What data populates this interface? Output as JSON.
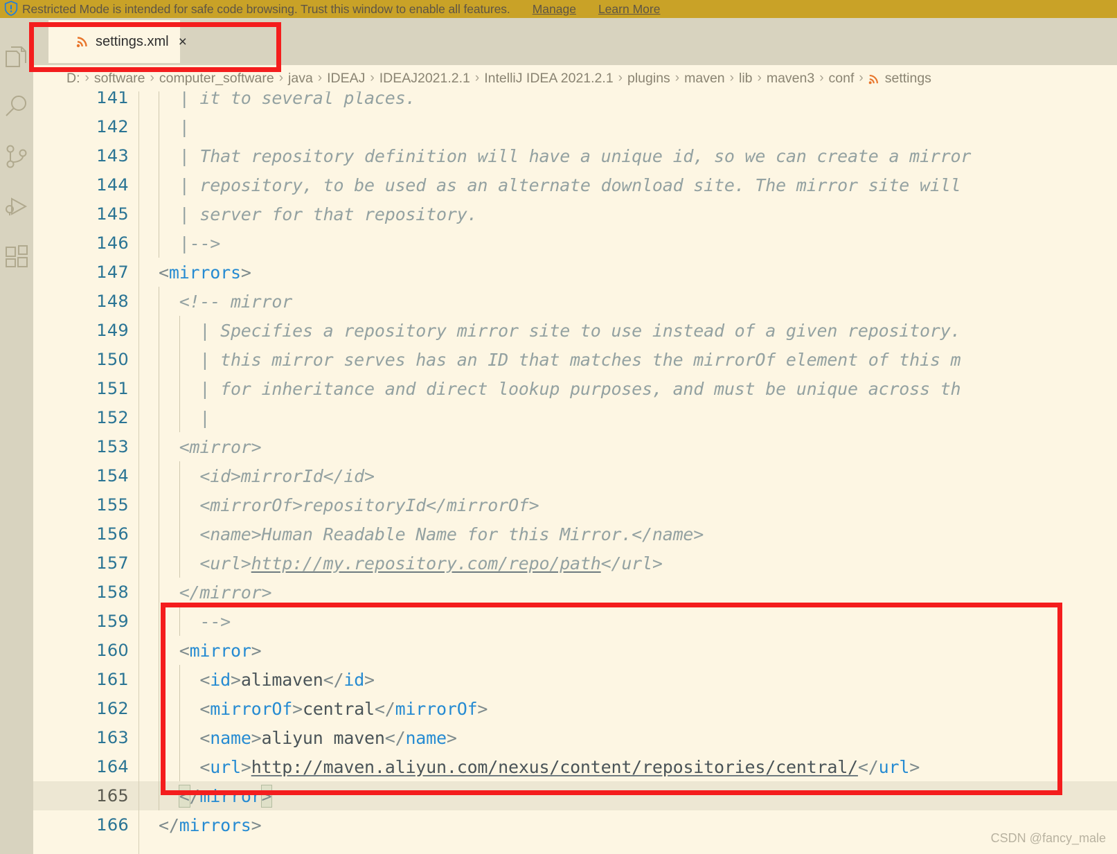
{
  "banner": {
    "icon": "shield-warning-icon",
    "message": "Restricted Mode is intended for safe code browsing. Trust this window to enable all features.",
    "manage_label": "Manage",
    "learn_more_label": "Learn More",
    "background_color": "#C9A227",
    "text_color": "#5E5545"
  },
  "activitybar": {
    "items": [
      {
        "icon": "explorer-files-icon",
        "label": "Explorer"
      },
      {
        "icon": "search-magnifier-icon",
        "label": "Search"
      },
      {
        "icon": "source-control-branch-icon",
        "label": "Source Control"
      },
      {
        "icon": "run-debug-play-icon",
        "label": "Run and Debug"
      },
      {
        "icon": "extensions-blocks-icon",
        "label": "Extensions"
      }
    ],
    "background_color": "#D8D3BF"
  },
  "tabs": [
    {
      "icon": "xml-file-icon",
      "label": "settings.xml",
      "close_label": "×",
      "active": true
    }
  ],
  "breadcrumb": {
    "icon": "xml-file-icon",
    "separator": "›",
    "items": [
      "D:",
      "software",
      "computer_software",
      "java",
      "IDEAJ",
      "IDEAJ2021.2.1",
      "IntelliJ IDEA 2021.2.1",
      "plugins",
      "maven",
      "lib",
      "maven3",
      "conf"
    ],
    "file": "settings"
  },
  "editor": {
    "background_color": "#FDF6E3",
    "line_number_color": "#2A7494",
    "active_line_color": "#EDE7D3",
    "comment_color": "#93A1A1",
    "tag_color": "#268BD2",
    "active_line": 165,
    "lines": [
      {
        "n": 141,
        "indent": 1,
        "guides": [
          1
        ],
        "parts": [
          {
            "t": "cmt",
            "s": "| it to several places."
          }
        ]
      },
      {
        "n": 142,
        "indent": 1,
        "guides": [
          1
        ],
        "parts": [
          {
            "t": "cmt",
            "s": "|"
          }
        ]
      },
      {
        "n": 143,
        "indent": 1,
        "guides": [
          1
        ],
        "parts": [
          {
            "t": "cmt",
            "s": "| That repository definition will have a unique id, so we can create a mirror"
          }
        ]
      },
      {
        "n": 144,
        "indent": 1,
        "guides": [
          1
        ],
        "parts": [
          {
            "t": "cmt",
            "s": "| repository, to be used as an alternate download site. The mirror site will"
          }
        ]
      },
      {
        "n": 145,
        "indent": 1,
        "guides": [
          1
        ],
        "parts": [
          {
            "t": "cmt",
            "s": "| server for that repository."
          }
        ]
      },
      {
        "n": 146,
        "indent": 1,
        "guides": [
          1
        ],
        "parts": [
          {
            "t": "cmt-plain",
            "s": "|-->"
          }
        ]
      },
      {
        "n": 147,
        "indent": 0,
        "guides": [],
        "parts": [
          {
            "t": "brk",
            "s": "<"
          },
          {
            "t": "tagname",
            "s": "mirrors"
          },
          {
            "t": "brk",
            "s": ">"
          }
        ]
      },
      {
        "n": 148,
        "indent": 1,
        "guides": [
          1
        ],
        "parts": [
          {
            "t": "cmt",
            "s": "<!-- mirror"
          }
        ]
      },
      {
        "n": 149,
        "indent": 2,
        "guides": [
          1,
          2
        ],
        "parts": [
          {
            "t": "cmt",
            "s": "| Specifies a repository mirror site to use instead of a given repository."
          }
        ]
      },
      {
        "n": 150,
        "indent": 2,
        "guides": [
          1,
          2
        ],
        "parts": [
          {
            "t": "cmt",
            "s": "| this mirror serves has an ID that matches the mirrorOf element of this m"
          }
        ]
      },
      {
        "n": 151,
        "indent": 2,
        "guides": [
          1,
          2
        ],
        "parts": [
          {
            "t": "cmt",
            "s": "| for inheritance and direct lookup purposes, and must be unique across th"
          }
        ]
      },
      {
        "n": 152,
        "indent": 2,
        "guides": [
          1,
          2
        ],
        "parts": [
          {
            "t": "cmt",
            "s": "|"
          }
        ]
      },
      {
        "n": 153,
        "indent": 1,
        "guides": [
          1
        ],
        "parts": [
          {
            "t": "cmt",
            "s": "<mirror>"
          }
        ]
      },
      {
        "n": 154,
        "indent": 2,
        "guides": [
          1,
          2
        ],
        "parts": [
          {
            "t": "cmt",
            "s": "<id>mirrorId</id>"
          }
        ]
      },
      {
        "n": 155,
        "indent": 2,
        "guides": [
          1,
          2
        ],
        "parts": [
          {
            "t": "cmt",
            "s": "<mirrorOf>repositoryId</mirrorOf>"
          }
        ]
      },
      {
        "n": 156,
        "indent": 2,
        "guides": [
          1,
          2
        ],
        "parts": [
          {
            "t": "cmt",
            "s": "<name>Human Readable Name for this Mirror.</name>"
          }
        ]
      },
      {
        "n": 157,
        "indent": 2,
        "guides": [
          1,
          2
        ],
        "parts": [
          {
            "t": "cmt",
            "s": "<url>"
          },
          {
            "t": "cmt-u",
            "s": "http://my.repository.com/repo/path"
          },
          {
            "t": "cmt",
            "s": "</url>"
          }
        ]
      },
      {
        "n": 158,
        "indent": 1,
        "guides": [
          1
        ],
        "parts": [
          {
            "t": "cmt",
            "s": "</mirror>"
          }
        ]
      },
      {
        "n": 159,
        "indent": 2,
        "guides": [
          1,
          2
        ],
        "parts": [
          {
            "t": "cmt-plain",
            "s": "-->"
          }
        ]
      },
      {
        "n": 160,
        "indent": 1,
        "guides": [
          1
        ],
        "parts": [
          {
            "t": "brk",
            "s": "<"
          },
          {
            "t": "tagname",
            "s": "mirror"
          },
          {
            "t": "brk",
            "s": ">"
          }
        ]
      },
      {
        "n": 161,
        "indent": 2,
        "guides": [
          1,
          2
        ],
        "parts": [
          {
            "t": "brk",
            "s": "<"
          },
          {
            "t": "tagname",
            "s": "id"
          },
          {
            "t": "brk",
            "s": ">"
          },
          {
            "t": "txt",
            "s": "alimaven"
          },
          {
            "t": "brk",
            "s": "</"
          },
          {
            "t": "tagname",
            "s": "id"
          },
          {
            "t": "brk",
            "s": ">"
          }
        ]
      },
      {
        "n": 162,
        "indent": 2,
        "guides": [
          1,
          2
        ],
        "parts": [
          {
            "t": "brk",
            "s": "<"
          },
          {
            "t": "tagname",
            "s": "mirrorOf"
          },
          {
            "t": "brk",
            "s": ">"
          },
          {
            "t": "txt",
            "s": "central"
          },
          {
            "t": "brk",
            "s": "</"
          },
          {
            "t": "tagname",
            "s": "mirrorOf"
          },
          {
            "t": "brk",
            "s": ">"
          }
        ]
      },
      {
        "n": 163,
        "indent": 2,
        "guides": [
          1,
          2
        ],
        "parts": [
          {
            "t": "brk",
            "s": "<"
          },
          {
            "t": "tagname",
            "s": "name"
          },
          {
            "t": "brk",
            "s": ">"
          },
          {
            "t": "txt",
            "s": "aliyun maven"
          },
          {
            "t": "brk",
            "s": "</"
          },
          {
            "t": "tagname",
            "s": "name"
          },
          {
            "t": "brk",
            "s": ">"
          }
        ]
      },
      {
        "n": 164,
        "indent": 2,
        "guides": [
          1,
          2
        ],
        "parts": [
          {
            "t": "brk",
            "s": "<"
          },
          {
            "t": "tagname",
            "s": "url"
          },
          {
            "t": "brk",
            "s": ">"
          },
          {
            "t": "txt-u",
            "s": "http://maven.aliyun.com/nexus/content/repositories/central/"
          },
          {
            "t": "brk",
            "s": "</"
          },
          {
            "t": "tagname",
            "s": "url"
          },
          {
            "t": "brk",
            "s": ">"
          }
        ]
      },
      {
        "n": 165,
        "indent": 1,
        "guides": [
          1
        ],
        "active": true,
        "parts": [
          {
            "t": "brk-hl",
            "s": "<"
          },
          {
            "t": "brk",
            "s": "/"
          },
          {
            "t": "tagname",
            "s": "mirror"
          },
          {
            "t": "brk-hl",
            "s": ">"
          }
        ]
      },
      {
        "n": 166,
        "indent": 0,
        "guides": [],
        "parts": [
          {
            "t": "brk",
            "s": "</"
          },
          {
            "t": "tagname",
            "s": "mirrors"
          },
          {
            "t": "brk",
            "s": ">"
          }
        ]
      }
    ]
  },
  "annotations": [
    {
      "name": "tab-highlight-box",
      "color": "#F41D1D"
    },
    {
      "name": "mirror-block-highlight-box",
      "color": "#F41D1D"
    }
  ],
  "watermark": "CSDN @fancy_male"
}
